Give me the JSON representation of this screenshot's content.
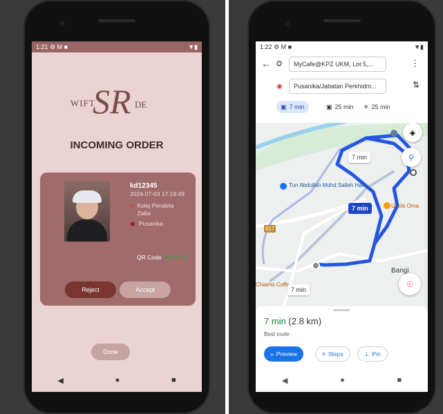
{
  "left": {
    "status": {
      "time": "1:21",
      "icons": "⚙ M ■",
      "right_icons": "▼▮"
    },
    "logo": {
      "left": "WIFT",
      "mark": "SR",
      "right": "DE"
    },
    "title": "INCOMING ORDER",
    "order": {
      "username": "kd12345",
      "timestamp": "2024-07-03 17:19:49",
      "pickup": "Kolej Pendeta Zaba",
      "dropoff": "Pusanika",
      "qr_label": "QR Code",
      "amount": "+RM3.00"
    },
    "buttons": {
      "reject": "Reject",
      "accept": "Accept",
      "done": "Done"
    },
    "nav": {
      "back": "◀",
      "home": "●",
      "recent": "■"
    }
  },
  "right": {
    "status": {
      "time": "1:22",
      "icons": "⚙ M ■",
      "right_icons": "▼▮"
    },
    "origin": "MyCafe@KPZ UKM, Lot 5,...",
    "destination": "Pusanika/Jabatan Perkhidm...",
    "modes": [
      {
        "icon": "car-icon",
        "label": "7 min"
      },
      {
        "icon": "motorbike-icon",
        "label": "25 min"
      },
      {
        "icon": "walk-icon",
        "label": "25 min"
      }
    ],
    "map": {
      "labels": {
        "poi1": "Tun Abdullah Mohd Salleh Hall",
        "poi2": "Uncle Oma",
        "poi3": "Bangi",
        "poi4": "Chiamo Coffe",
        "road": "817"
      },
      "badges": {
        "top": "7 min",
        "mid": "7 min",
        "bottom": "7 min"
      }
    },
    "sheet": {
      "eta_time": "7 min",
      "eta_dist": "(2.8 km)",
      "best": "Best route",
      "preview": "Preview",
      "steps": "Steps",
      "pin": "Pin"
    },
    "nav": {
      "back": "◀",
      "home": "●",
      "recent": "■"
    }
  },
  "colors": {
    "brand": "#a06b6a",
    "route": "#2457e0",
    "eta": "#188038"
  }
}
